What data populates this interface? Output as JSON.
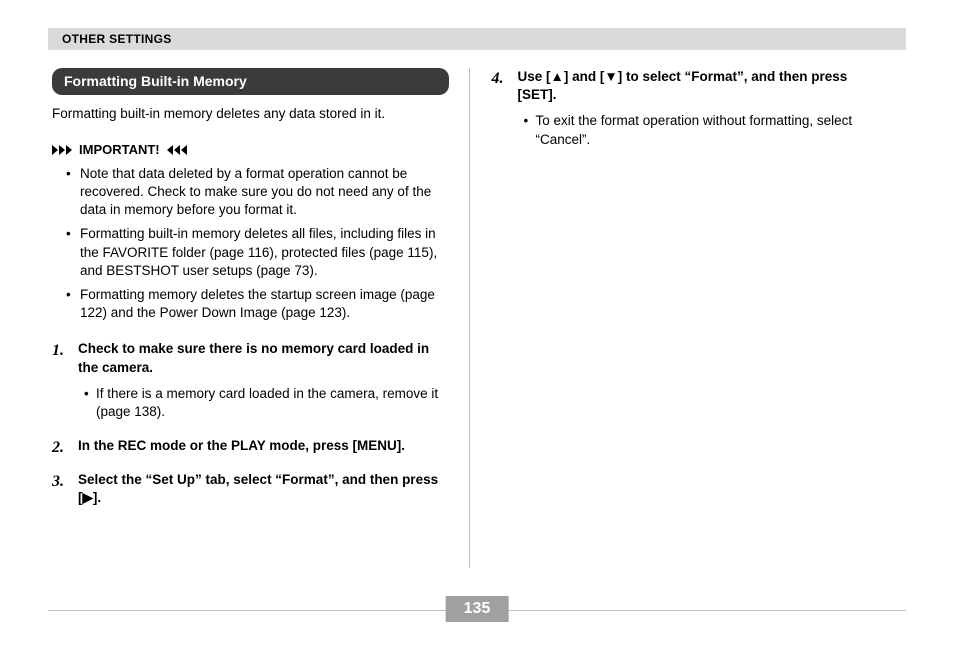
{
  "header": {
    "breadcrumb": "OTHER SETTINGS"
  },
  "section": {
    "title": "Formatting Built-in Memory"
  },
  "intro": "Formatting built-in memory deletes any data stored in it.",
  "important": {
    "label": "IMPORTANT!",
    "items": [
      "Note that data deleted by a format operation cannot be recovered. Check to make sure you do not need any of the data in memory before you format it.",
      "Formatting built-in memory deletes all files, including files in the FAVORITE folder (page 116), protected files (page 115), and BESTSHOT user setups (page 73).",
      "Formatting memory deletes the startup screen image (page 122) and the Power Down Image (page 123)."
    ]
  },
  "steps": [
    {
      "num": "1.",
      "text": "Check to make sure there is no memory card loaded in the camera.",
      "sub": [
        "If there is a memory card loaded in the camera, remove it (page 138)."
      ]
    },
    {
      "num": "2.",
      "text": "In the REC mode or the PLAY mode, press [MENU]."
    },
    {
      "num": "3.",
      "text": "Select the “Set Up” tab, select “Format”, and then press [▶]."
    },
    {
      "num": "4.",
      "text": "Use [▲] and [▼] to select “Format”, and then press [SET].",
      "sub": [
        "To exit the format operation without formatting, select “Cancel”."
      ]
    }
  ],
  "page_number": "135"
}
